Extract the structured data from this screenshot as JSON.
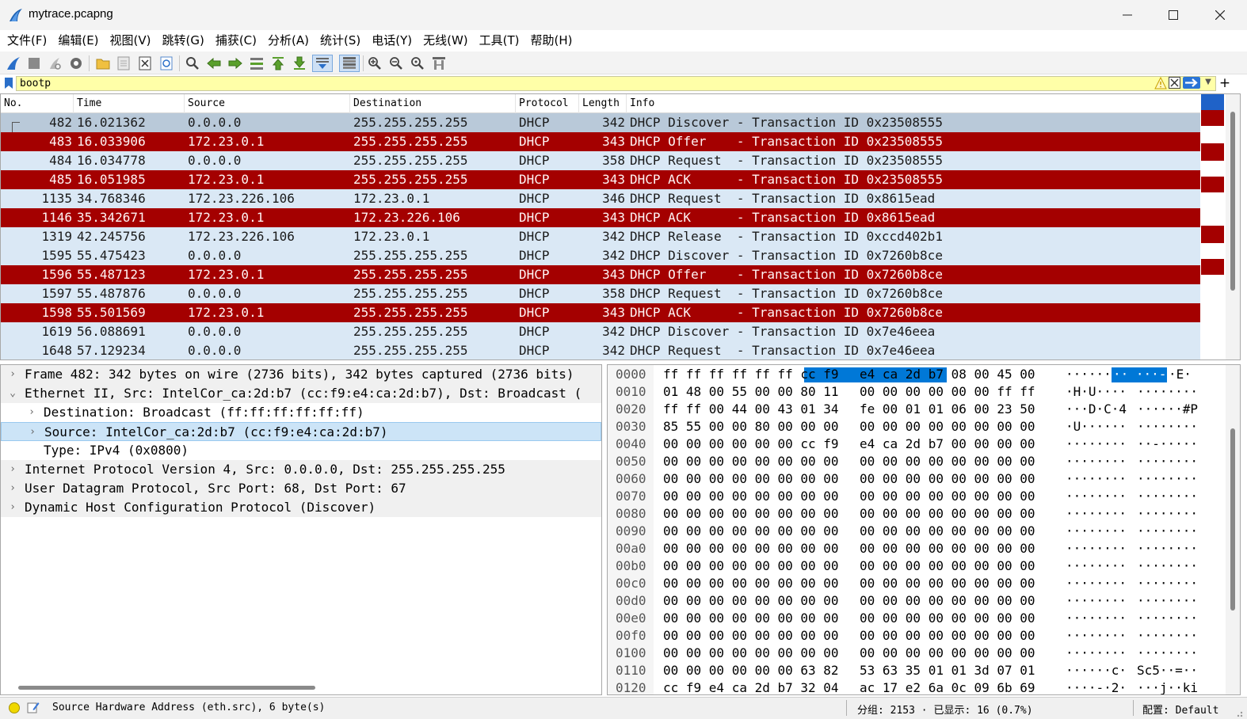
{
  "window": {
    "title": "mytrace.pcapng",
    "min_icon": "minimize-icon",
    "max_icon": "maximize-icon",
    "close_icon": "close-icon"
  },
  "menu": [
    "文件(F)",
    "编辑(E)",
    "视图(V)",
    "跳转(G)",
    "捕获(C)",
    "分析(A)",
    "统计(S)",
    "电话(Y)",
    "无线(W)",
    "工具(T)",
    "帮助(H)"
  ],
  "toolbar": [
    "start-capture-icon",
    "stop-capture-icon",
    "restart-capture-icon",
    "capture-options-icon",
    "open-file-icon",
    "save-file-icon",
    "close-file-icon",
    "reload-file-icon",
    "find-packet-icon",
    "go-back-icon",
    "go-forward-icon",
    "go-to-packet-icon",
    "go-first-icon",
    "go-last-icon",
    "auto-scroll-icon",
    "colorize-icon",
    "zoom-in-icon",
    "zoom-out-icon",
    "zoom-normal-icon",
    "resize-columns-icon"
  ],
  "filter": {
    "value": "bootp",
    "bookmark_icon": "bookmark-icon",
    "warning_icon": "warning-icon",
    "clear_icon": "clear-filter-icon",
    "apply_icon": "apply-filter-icon",
    "dropdown_icon": "chevron-down-icon",
    "add": "+"
  },
  "packet_list": {
    "columns": [
      "No.",
      "Time",
      "Source",
      "Destination",
      "Protocol",
      "Length",
      "Info"
    ],
    "rows": [
      {
        "no": "482",
        "time": "16.021362",
        "src": "0.0.0.0",
        "dst": "255.255.255.255",
        "proto": "DHCP",
        "len": "342",
        "info": "DHCP Discover - Transaction ID 0x23508555",
        "style": "sel"
      },
      {
        "no": "483",
        "time": "16.033906",
        "src": "172.23.0.1",
        "dst": "255.255.255.255",
        "proto": "DHCP",
        "len": "343",
        "info": "DHCP Offer    - Transaction ID 0x23508555",
        "style": "dark"
      },
      {
        "no": "484",
        "time": "16.034778",
        "src": "0.0.0.0",
        "dst": "255.255.255.255",
        "proto": "DHCP",
        "len": "358",
        "info": "DHCP Request  - Transaction ID 0x23508555",
        "style": "light"
      },
      {
        "no": "485",
        "time": "16.051985",
        "src": "172.23.0.1",
        "dst": "255.255.255.255",
        "proto": "DHCP",
        "len": "343",
        "info": "DHCP ACK      - Transaction ID 0x23508555",
        "style": "dark"
      },
      {
        "no": "1135",
        "time": "34.768346",
        "src": "172.23.226.106",
        "dst": "172.23.0.1",
        "proto": "DHCP",
        "len": "346",
        "info": "DHCP Request  - Transaction ID 0x8615ead",
        "style": "light"
      },
      {
        "no": "1146",
        "time": "35.342671",
        "src": "172.23.0.1",
        "dst": "172.23.226.106",
        "proto": "DHCP",
        "len": "343",
        "info": "DHCP ACK      - Transaction ID 0x8615ead",
        "style": "dark"
      },
      {
        "no": "1319",
        "time": "42.245756",
        "src": "172.23.226.106",
        "dst": "172.23.0.1",
        "proto": "DHCP",
        "len": "342",
        "info": "DHCP Release  - Transaction ID 0xccd402b1",
        "style": "light"
      },
      {
        "no": "1595",
        "time": "55.475423",
        "src": "0.0.0.0",
        "dst": "255.255.255.255",
        "proto": "DHCP",
        "len": "342",
        "info": "DHCP Discover - Transaction ID 0x7260b8ce",
        "style": "light"
      },
      {
        "no": "1596",
        "time": "55.487123",
        "src": "172.23.0.1",
        "dst": "255.255.255.255",
        "proto": "DHCP",
        "len": "343",
        "info": "DHCP Offer    - Transaction ID 0x7260b8ce",
        "style": "dark"
      },
      {
        "no": "1597",
        "time": "55.487876",
        "src": "0.0.0.0",
        "dst": "255.255.255.255",
        "proto": "DHCP",
        "len": "358",
        "info": "DHCP Request  - Transaction ID 0x7260b8ce",
        "style": "light"
      },
      {
        "no": "1598",
        "time": "55.501569",
        "src": "172.23.0.1",
        "dst": "255.255.255.255",
        "proto": "DHCP",
        "len": "343",
        "info": "DHCP ACK      - Transaction ID 0x7260b8ce",
        "style": "dark"
      },
      {
        "no": "1619",
        "time": "56.088691",
        "src": "0.0.0.0",
        "dst": "255.255.255.255",
        "proto": "DHCP",
        "len": "342",
        "info": "DHCP Discover - Transaction ID 0x7e46eea",
        "style": "light"
      },
      {
        "no": "1648",
        "time": "57.129234",
        "src": "0.0.0.0",
        "dst": "255.255.255.255",
        "proto": "DHCP",
        "len": "342",
        "info": "DHCP Request  - Transaction ID 0x7e46eea",
        "style": "light"
      }
    ]
  },
  "details": [
    {
      "arrow": "›",
      "indent": 0,
      "text": "Frame 482: 342 bytes on wire (2736 bits), 342 bytes captured (2736 bits)",
      "style": "alt"
    },
    {
      "arrow": "⌄",
      "indent": 0,
      "text": "Ethernet II, Src: IntelCor_ca:2d:b7 (cc:f9:e4:ca:2d:b7), Dst: Broadcast (",
      "style": "alt"
    },
    {
      "arrow": "›",
      "indent": 1,
      "text": "Destination: Broadcast (ff:ff:ff:ff:ff:ff)",
      "style": ""
    },
    {
      "arrow": "›",
      "indent": 1,
      "text": "Source: IntelCor_ca:2d:b7 (cc:f9:e4:ca:2d:b7)",
      "style": "sel"
    },
    {
      "arrow": "",
      "indent": 1,
      "text": "Type: IPv4 (0x0800)",
      "style": ""
    },
    {
      "arrow": "›",
      "indent": 0,
      "text": "Internet Protocol Version 4, Src: 0.0.0.0, Dst: 255.255.255.255",
      "style": "alt"
    },
    {
      "arrow": "›",
      "indent": 0,
      "text": "User Datagram Protocol, Src Port: 68, Dst Port: 67",
      "style": "alt"
    },
    {
      "arrow": "›",
      "indent": 0,
      "text": "Dynamic Host Configuration Protocol (Discover)",
      "style": "alt"
    }
  ],
  "hex": [
    {
      "off": "0000",
      "b1": "ff ff ff ff ff ff cc f9",
      "b2": "e4 ca 2d b7 08 00 45 00",
      "a1": "······",
      "ahl": "·· ···-",
      "a2": "·E·"
    },
    {
      "off": "0010",
      "b1": "01 48 00 55 00 00 80 11",
      "b2": "00 00 00 00 00 00 ff ff",
      "a1": "·H·U····",
      "a2": "········"
    },
    {
      "off": "0020",
      "b1": "ff ff 00 44 00 43 01 34",
      "b2": "fe 00 01 01 06 00 23 50",
      "a1": "···D·C·4",
      "a2": "······#P"
    },
    {
      "off": "0030",
      "b1": "85 55 00 00 80 00 00 00",
      "b2": "00 00 00 00 00 00 00 00",
      "a1": "·U······",
      "a2": "········"
    },
    {
      "off": "0040",
      "b1": "00 00 00 00 00 00 cc f9",
      "b2": "e4 ca 2d b7 00 00 00 00",
      "a1": "········",
      "a2": "··-·····"
    },
    {
      "off": "0050",
      "b1": "00 00 00 00 00 00 00 00",
      "b2": "00 00 00 00 00 00 00 00",
      "a1": "········",
      "a2": "········"
    },
    {
      "off": "0060",
      "b1": "00 00 00 00 00 00 00 00",
      "b2": "00 00 00 00 00 00 00 00",
      "a1": "········",
      "a2": "········"
    },
    {
      "off": "0070",
      "b1": "00 00 00 00 00 00 00 00",
      "b2": "00 00 00 00 00 00 00 00",
      "a1": "········",
      "a2": "········"
    },
    {
      "off": "0080",
      "b1": "00 00 00 00 00 00 00 00",
      "b2": "00 00 00 00 00 00 00 00",
      "a1": "········",
      "a2": "········"
    },
    {
      "off": "0090",
      "b1": "00 00 00 00 00 00 00 00",
      "b2": "00 00 00 00 00 00 00 00",
      "a1": "········",
      "a2": "········"
    },
    {
      "off": "00a0",
      "b1": "00 00 00 00 00 00 00 00",
      "b2": "00 00 00 00 00 00 00 00",
      "a1": "········",
      "a2": "········"
    },
    {
      "off": "00b0",
      "b1": "00 00 00 00 00 00 00 00",
      "b2": "00 00 00 00 00 00 00 00",
      "a1": "········",
      "a2": "········"
    },
    {
      "off": "00c0",
      "b1": "00 00 00 00 00 00 00 00",
      "b2": "00 00 00 00 00 00 00 00",
      "a1": "········",
      "a2": "········"
    },
    {
      "off": "00d0",
      "b1": "00 00 00 00 00 00 00 00",
      "b2": "00 00 00 00 00 00 00 00",
      "a1": "········",
      "a2": "········"
    },
    {
      "off": "00e0",
      "b1": "00 00 00 00 00 00 00 00",
      "b2": "00 00 00 00 00 00 00 00",
      "a1": "········",
      "a2": "········"
    },
    {
      "off": "00f0",
      "b1": "00 00 00 00 00 00 00 00",
      "b2": "00 00 00 00 00 00 00 00",
      "a1": "········",
      "a2": "········"
    },
    {
      "off": "0100",
      "b1": "00 00 00 00 00 00 00 00",
      "b2": "00 00 00 00 00 00 00 00",
      "a1": "········",
      "a2": "········"
    },
    {
      "off": "0110",
      "b1": "00 00 00 00 00 00 63 82",
      "b2": "53 63 35 01 01 3d 07 01",
      "a1": "······c·",
      "a2": "Sc5··=··"
    },
    {
      "off": "0120",
      "b1": "cc f9 e4 ca 2d b7 32 04",
      "b2": "ac 17 e2 6a 0c 09 6b 69",
      "a1": "····-·2·",
      "a2": "···j··ki"
    }
  ],
  "status": {
    "field": "Source Hardware Address (eth.src), 6 byte(s)",
    "counts": "分组: 2153 · 已显示: 16 (0.7%)",
    "profile": "配置: Default",
    "led_icon": "status-led-icon",
    "edit_icon": "edit-comment-icon",
    "grip_icon": "resize-grip-icon"
  },
  "colors": {
    "row_dark": "#a40000",
    "row_light": "#dae8f5",
    "row_selected": "#b9c9d9",
    "filter_bg": "#ffffa8",
    "hex_highlight": "#0078d7"
  }
}
